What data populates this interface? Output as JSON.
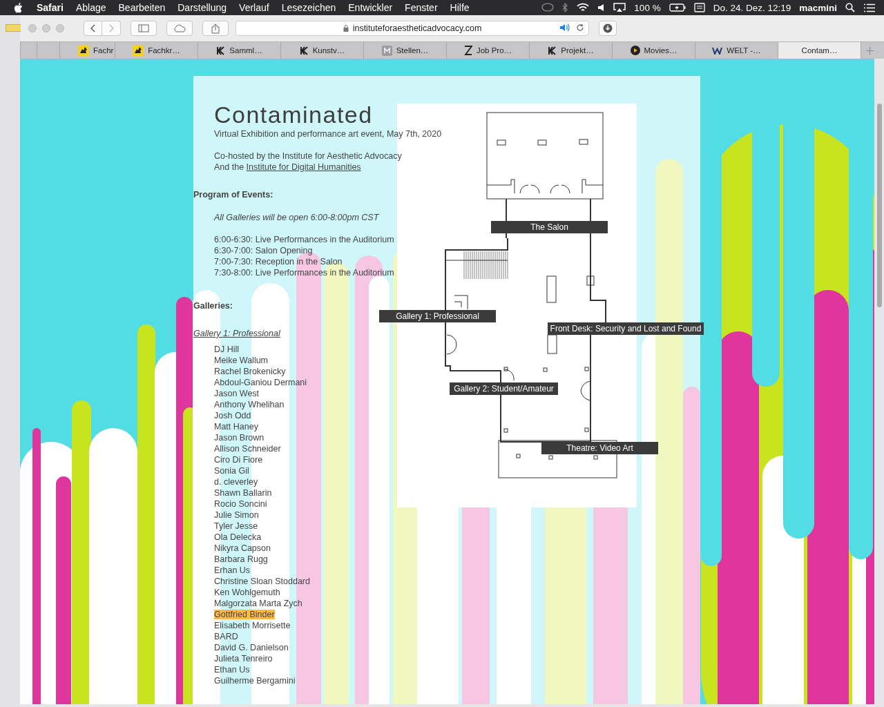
{
  "menu_bar": {
    "app": "Safari",
    "items": [
      "Ablage",
      "Bearbeiten",
      "Darstellung",
      "Verlauf",
      "Lesezeichen",
      "Entwickler",
      "Fenster",
      "Hilfe"
    ],
    "battery": "100 %",
    "clock": "Do. 24. Dez.  12:19",
    "user": "macmini"
  },
  "toolbar": {
    "url": "instituteforaestheticadvocacy.com"
  },
  "tabs": [
    {
      "label": "Fachr",
      "selected": false
    },
    {
      "label": "Fachkr…",
      "selected": false
    },
    {
      "label": "Samml…",
      "selected": false
    },
    {
      "label": "Kunstv…",
      "selected": false
    },
    {
      "label": "Stellen…",
      "selected": false
    },
    {
      "label": "Job Pro…",
      "selected": false
    },
    {
      "label": "Projekt…",
      "selected": false
    },
    {
      "label": "Movies…",
      "selected": false
    },
    {
      "label": "WELT -…",
      "selected": false
    },
    {
      "label": "Contam…",
      "selected": true
    }
  ],
  "page": {
    "title": "Contaminated",
    "subtitle": "Virtual Exhibition and performance art event, May 7th, 2020",
    "cohost": "Co-hosted by the Institute for Aesthetic Advocacy",
    "cohost_prefix": "And the",
    "cohost_link": "Institute for Digital Humanities",
    "program_heading": "Program of Events:",
    "program_note": "All Galleries will be open 6:00-8:00pm CST",
    "schedule": [
      "6:00-6:30: Live Performances in the Auditorium",
      "6:30-7:00: Salon Opening",
      "7:00-7:30: Reception in the Salon",
      "7:30-8:00: Live Performances in the Auditorium"
    ],
    "galleries_heading": "Galleries:",
    "gallery_link": "Gallery 1: Professional",
    "artists": [
      {
        "name": "DJ Hill",
        "highlighted": false
      },
      {
        "name": "Meike Wallum",
        "highlighted": false
      },
      {
        "name": "Rachel Brokenicky",
        "highlighted": false
      },
      {
        "name": "Abdoul-Ganiou Dermani",
        "highlighted": false
      },
      {
        "name": "Jason West",
        "highlighted": false
      },
      {
        "name": "Anthony Whelihan",
        "highlighted": false
      },
      {
        "name": "Josh Odd",
        "highlighted": false
      },
      {
        "name": "Matt Haney",
        "highlighted": false
      },
      {
        "name": "Jason Brown",
        "highlighted": false
      },
      {
        "name": "Allison Schneider",
        "highlighted": false
      },
      {
        "name": "Ciro Di Fiore",
        "highlighted": false
      },
      {
        "name": "Sonia Gil",
        "highlighted": false
      },
      {
        "name": "d. cleverley",
        "highlighted": false
      },
      {
        "name": "Shawn Ballarin",
        "highlighted": false
      },
      {
        "name": "Rocio Soncini",
        "highlighted": false
      },
      {
        "name": "Julie Simon",
        "highlighted": false
      },
      {
        "name": "Tyler Jesse",
        "highlighted": false
      },
      {
        "name": "Ola Delecka",
        "highlighted": false
      },
      {
        "name": "Nikyra Capson",
        "highlighted": false
      },
      {
        "name": "Barbara Rugg",
        "highlighted": false
      },
      {
        "name": "Erhan Us",
        "highlighted": false
      },
      {
        "name": "Christine Sloan Stoddard",
        "highlighted": false
      },
      {
        "name": "Ken Wohlgemuth",
        "highlighted": false
      },
      {
        "name": "Malgorzata Marta Zych",
        "highlighted": false
      },
      {
        "name": "Gottfried Binder",
        "highlighted": true
      },
      {
        "name": "Elisabeth Morrisette",
        "highlighted": false
      },
      {
        "name": "BARD",
        "highlighted": false
      },
      {
        "name": "David G. Danielson",
        "highlighted": false
      },
      {
        "name": "Julieta Tenreiro",
        "highlighted": false
      },
      {
        "name": "Ethan Us",
        "highlighted": false
      },
      {
        "name": "Guilherme Bergamini",
        "highlighted": false
      }
    ],
    "floor_plan_labels": [
      "The Salon",
      "Gallery 1: Professional",
      "Front Desk: Security and Lost and Found",
      "Gallery 2: Student/Amateur",
      "Theatre: Video Art"
    ]
  }
}
